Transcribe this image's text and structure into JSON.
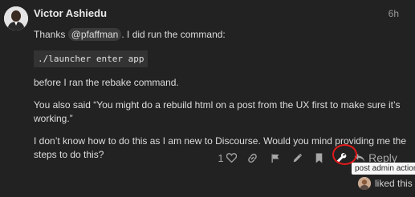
{
  "post": {
    "username": "Victor Ashiedu",
    "timestamp": "6h",
    "body": {
      "thanks_prefix": "Thanks ",
      "mention": "@pfaffman",
      "thanks_suffix": ". I did run the command:",
      "code": "./launcher enter app",
      "para2": "before I ran the rebake command.",
      "para3": "You also said “You might do a rebuild html on a post from the UX first to make sure it’s working.”",
      "para4": "I don’t know how to do this as I am new to Discourse. Would you mind providing me the steps to do this?"
    }
  },
  "actions": {
    "like_count": "1",
    "reply_label": "Reply",
    "tooltip": "post admin actions",
    "icons": [
      "heart-icon",
      "link-icon",
      "flag-icon",
      "pencil-icon",
      "bookmark-icon",
      "wrench-icon",
      "reply-arrow-icon"
    ]
  },
  "likes": {
    "liked_text": "liked this"
  },
  "colors": {
    "background": "#222222",
    "highlight_ring": "#e0191b",
    "action_gray": "#a7a7a7"
  }
}
